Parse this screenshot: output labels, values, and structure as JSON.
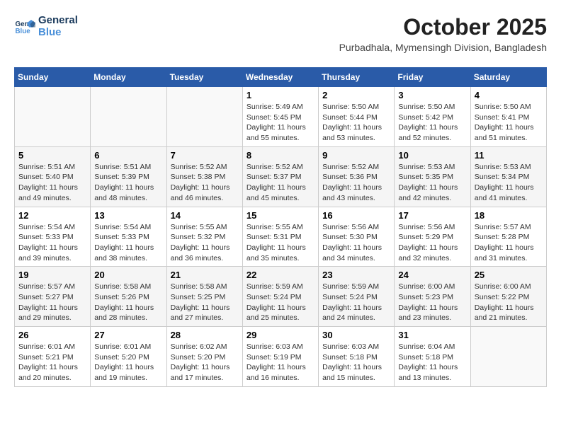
{
  "logo": {
    "line1": "General",
    "line2": "Blue"
  },
  "header": {
    "title": "October 2025",
    "subtitle": "Purbadhala, Mymensingh Division, Bangladesh"
  },
  "weekdays": [
    "Sunday",
    "Monday",
    "Tuesday",
    "Wednesday",
    "Thursday",
    "Friday",
    "Saturday"
  ],
  "weeks": [
    [
      {
        "num": "",
        "info": ""
      },
      {
        "num": "",
        "info": ""
      },
      {
        "num": "",
        "info": ""
      },
      {
        "num": "1",
        "info": "Sunrise: 5:49 AM\nSunset: 5:45 PM\nDaylight: 11 hours and 55 minutes."
      },
      {
        "num": "2",
        "info": "Sunrise: 5:50 AM\nSunset: 5:44 PM\nDaylight: 11 hours and 53 minutes."
      },
      {
        "num": "3",
        "info": "Sunrise: 5:50 AM\nSunset: 5:42 PM\nDaylight: 11 hours and 52 minutes."
      },
      {
        "num": "4",
        "info": "Sunrise: 5:50 AM\nSunset: 5:41 PM\nDaylight: 11 hours and 51 minutes."
      }
    ],
    [
      {
        "num": "5",
        "info": "Sunrise: 5:51 AM\nSunset: 5:40 PM\nDaylight: 11 hours and 49 minutes."
      },
      {
        "num": "6",
        "info": "Sunrise: 5:51 AM\nSunset: 5:39 PM\nDaylight: 11 hours and 48 minutes."
      },
      {
        "num": "7",
        "info": "Sunrise: 5:52 AM\nSunset: 5:38 PM\nDaylight: 11 hours and 46 minutes."
      },
      {
        "num": "8",
        "info": "Sunrise: 5:52 AM\nSunset: 5:37 PM\nDaylight: 11 hours and 45 minutes."
      },
      {
        "num": "9",
        "info": "Sunrise: 5:52 AM\nSunset: 5:36 PM\nDaylight: 11 hours and 43 minutes."
      },
      {
        "num": "10",
        "info": "Sunrise: 5:53 AM\nSunset: 5:35 PM\nDaylight: 11 hours and 42 minutes."
      },
      {
        "num": "11",
        "info": "Sunrise: 5:53 AM\nSunset: 5:34 PM\nDaylight: 11 hours and 41 minutes."
      }
    ],
    [
      {
        "num": "12",
        "info": "Sunrise: 5:54 AM\nSunset: 5:33 PM\nDaylight: 11 hours and 39 minutes."
      },
      {
        "num": "13",
        "info": "Sunrise: 5:54 AM\nSunset: 5:33 PM\nDaylight: 11 hours and 38 minutes."
      },
      {
        "num": "14",
        "info": "Sunrise: 5:55 AM\nSunset: 5:32 PM\nDaylight: 11 hours and 36 minutes."
      },
      {
        "num": "15",
        "info": "Sunrise: 5:55 AM\nSunset: 5:31 PM\nDaylight: 11 hours and 35 minutes."
      },
      {
        "num": "16",
        "info": "Sunrise: 5:56 AM\nSunset: 5:30 PM\nDaylight: 11 hours and 34 minutes."
      },
      {
        "num": "17",
        "info": "Sunrise: 5:56 AM\nSunset: 5:29 PM\nDaylight: 11 hours and 32 minutes."
      },
      {
        "num": "18",
        "info": "Sunrise: 5:57 AM\nSunset: 5:28 PM\nDaylight: 11 hours and 31 minutes."
      }
    ],
    [
      {
        "num": "19",
        "info": "Sunrise: 5:57 AM\nSunset: 5:27 PM\nDaylight: 11 hours and 29 minutes."
      },
      {
        "num": "20",
        "info": "Sunrise: 5:58 AM\nSunset: 5:26 PM\nDaylight: 11 hours and 28 minutes."
      },
      {
        "num": "21",
        "info": "Sunrise: 5:58 AM\nSunset: 5:25 PM\nDaylight: 11 hours and 27 minutes."
      },
      {
        "num": "22",
        "info": "Sunrise: 5:59 AM\nSunset: 5:24 PM\nDaylight: 11 hours and 25 minutes."
      },
      {
        "num": "23",
        "info": "Sunrise: 5:59 AM\nSunset: 5:24 PM\nDaylight: 11 hours and 24 minutes."
      },
      {
        "num": "24",
        "info": "Sunrise: 6:00 AM\nSunset: 5:23 PM\nDaylight: 11 hours and 23 minutes."
      },
      {
        "num": "25",
        "info": "Sunrise: 6:00 AM\nSunset: 5:22 PM\nDaylight: 11 hours and 21 minutes."
      }
    ],
    [
      {
        "num": "26",
        "info": "Sunrise: 6:01 AM\nSunset: 5:21 PM\nDaylight: 11 hours and 20 minutes."
      },
      {
        "num": "27",
        "info": "Sunrise: 6:01 AM\nSunset: 5:20 PM\nDaylight: 11 hours and 19 minutes."
      },
      {
        "num": "28",
        "info": "Sunrise: 6:02 AM\nSunset: 5:20 PM\nDaylight: 11 hours and 17 minutes."
      },
      {
        "num": "29",
        "info": "Sunrise: 6:03 AM\nSunset: 5:19 PM\nDaylight: 11 hours and 16 minutes."
      },
      {
        "num": "30",
        "info": "Sunrise: 6:03 AM\nSunset: 5:18 PM\nDaylight: 11 hours and 15 minutes."
      },
      {
        "num": "31",
        "info": "Sunrise: 6:04 AM\nSunset: 5:18 PM\nDaylight: 11 hours and 13 minutes."
      },
      {
        "num": "",
        "info": ""
      }
    ]
  ]
}
